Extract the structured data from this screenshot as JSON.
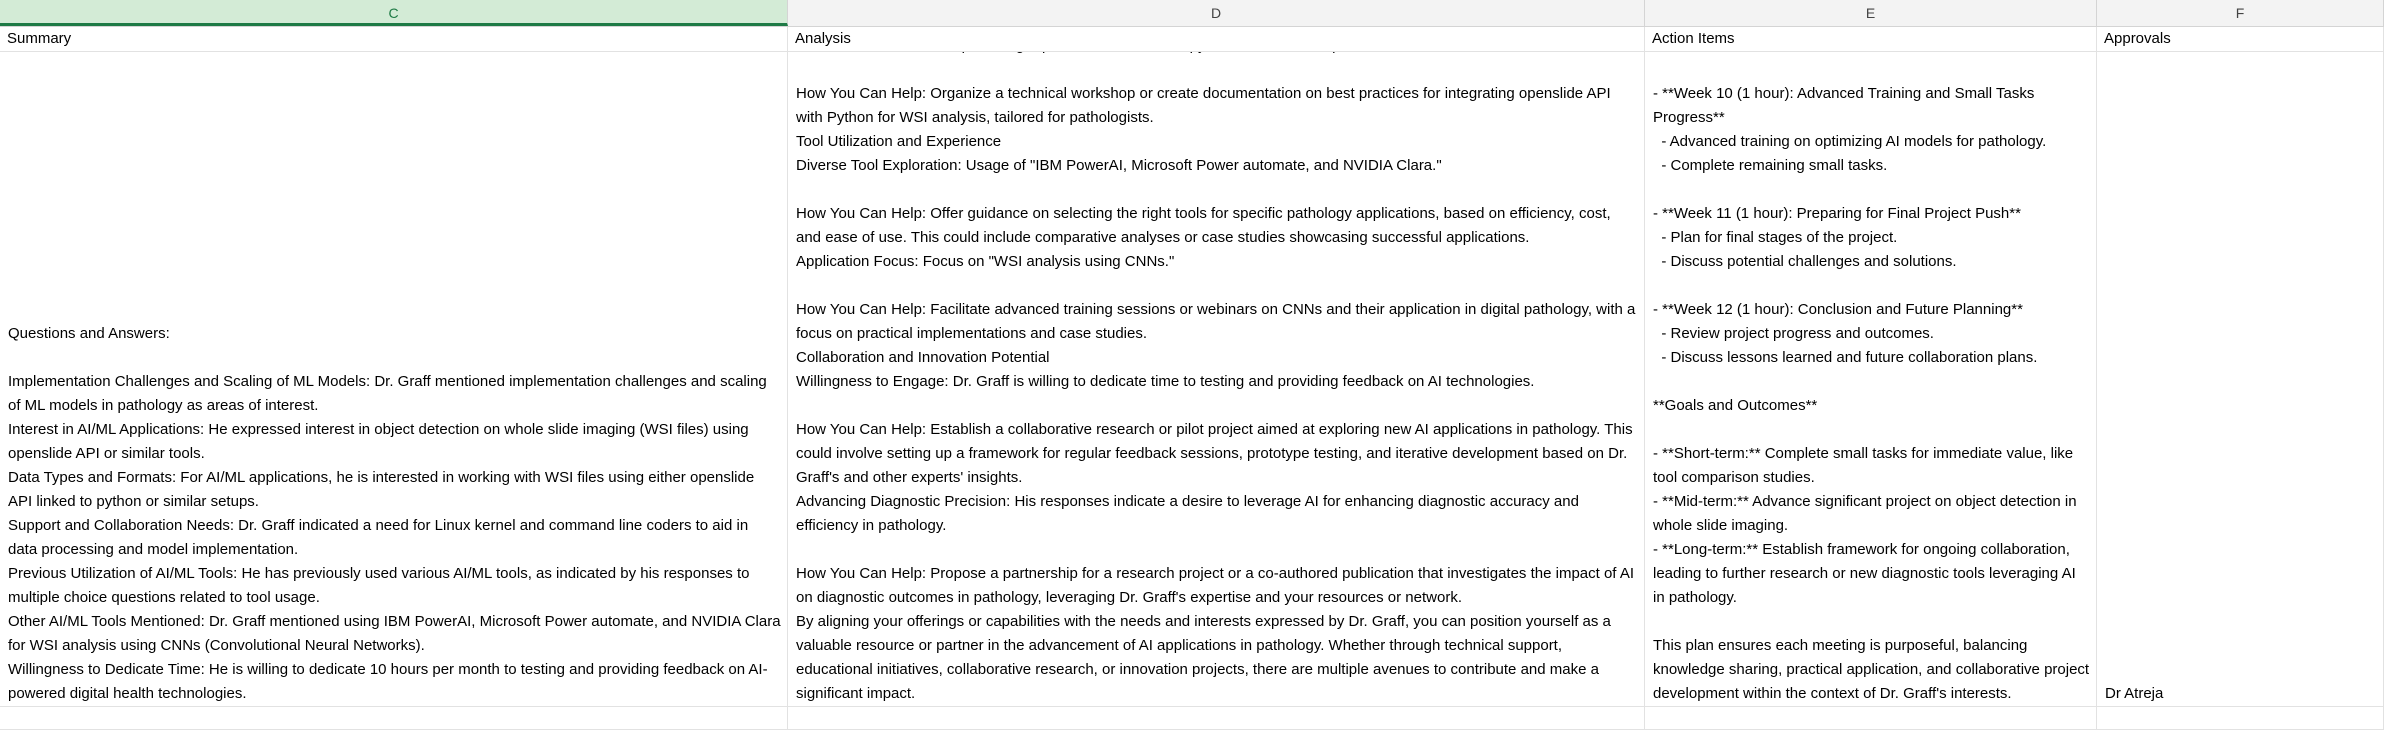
{
  "columns": [
    {
      "letter": "C",
      "selected": true
    },
    {
      "letter": "D",
      "selected": false
    },
    {
      "letter": "E",
      "selected": false
    },
    {
      "letter": "F",
      "selected": false
    }
  ],
  "header_row": {
    "summary": "Summary",
    "analysis": "Analysis",
    "action_items": "Action Items",
    "approvals": "Approvals"
  },
  "content_row": {
    "summary": "Questions and Answers:\n\nImplementation Challenges and Scaling of ML Models: Dr. Graff mentioned implementation challenges and scaling of ML models in pathology as areas of interest.\nInterest in AI/ML Applications: He expressed interest in object detection on whole slide imaging (WSI files) using openslide API or similar tools.\nData Types and Formats: For AI/ML applications, he is interested in working with WSI files using either openslide API linked to python or similar setups.\nSupport and Collaboration Needs: Dr. Graff indicated a need for Linux kernel and command line coders to aid in data processing and model implementation.\nPrevious Utilization of AI/ML Tools: He has previously used various AI/ML tools, as indicated by his responses to multiple choice questions related to tool usage.\nOther AI/ML Tools Mentioned: Dr. Graff mentioned using IBM PowerAI, Microsoft Power automate, and NVIDIA Clara for WSI analysis using CNNs (Convolutional Neural Networks).\nWillingness to Dedicate Time: He is willing to dedicate 10 hours per month to testing and providing feedback on AI-powered digital health technologies.",
    "analysis": "Preferred Tools and Setups: Using \"openslide API linked to python or similar setups.\"\n\nHow You Can Help: Organize a technical workshop or create documentation on best practices for integrating openslide API with Python for WSI analysis, tailored for pathologists.\nTool Utilization and Experience\nDiverse Tool Exploration: Usage of \"IBM PowerAI, Microsoft Power automate, and NVIDIA Clara.\"\n\nHow You Can Help: Offer guidance on selecting the right tools for specific pathology applications, based on efficiency, cost, and ease of use. This could include comparative analyses or case studies showcasing successful applications.\nApplication Focus: Focus on \"WSI analysis using CNNs.\"\n\nHow You Can Help: Facilitate advanced training sessions or webinars on CNNs and their application in digital pathology, with a focus on practical implementations and case studies.\nCollaboration and Innovation Potential\nWillingness to Engage: Dr. Graff is willing to dedicate time to testing and providing feedback on AI technologies.\n\nHow You Can Help: Establish a collaborative research or pilot project aimed at exploring new AI applications in pathology. This could involve setting up a framework for regular feedback sessions, prototype testing, and iterative development based on Dr. Graff's and other experts' insights.\nAdvancing Diagnostic Precision: His responses indicate a desire to leverage AI for enhancing diagnostic accuracy and efficiency in pathology.\n\nHow You Can Help: Propose a partnership for a research project or a co-authored publication that investigates the impact of AI on diagnostic outcomes in pathology, leveraging Dr. Graff's expertise and your resources or network.\nBy aligning your offerings or capabilities with the needs and interests expressed by Dr. Graff, you can position yourself as a valuable resource or partner in the advancement of AI applications in pathology. Whether through technical support, educational initiatives, collaborative research, or innovation projects, there are multiple avenues to contribute and make a significant impact.",
    "action_items": "- **Week 10 (1 hour): Advanced Training and Small Tasks Progress**\n  - Advanced training on optimizing AI models for pathology.\n  - Complete remaining small tasks.\n\n- **Week 11 (1 hour): Preparing for Final Project Push**\n  - Plan for final stages of the project.\n  - Discuss potential challenges and solutions.\n\n- **Week 12 (1 hour): Conclusion and Future Planning**\n  - Review project progress and outcomes.\n  - Discuss lessons learned and future collaboration plans.\n\n**Goals and Outcomes**\n\n- **Short-term:** Complete small tasks for immediate value, like tool comparison studies.\n- **Mid-term:** Advance significant project on object detection in whole slide imaging.\n- **Long-term:** Establish framework for ongoing collaboration, leading to further research or new diagnostic tools leveraging AI in pathology.\n\nThis plan ensures each meeting is purposeful, balancing knowledge sharing, practical application, and collaborative project development within the context of Dr. Graff's interests.",
    "approvals": "Dr Atreja"
  },
  "colors": {
    "header_bg": "#f3f3f3",
    "selected_header_bg": "#d3ebd6",
    "selected_accent": "#1e7a45",
    "gridline": "#e2e2e2"
  }
}
